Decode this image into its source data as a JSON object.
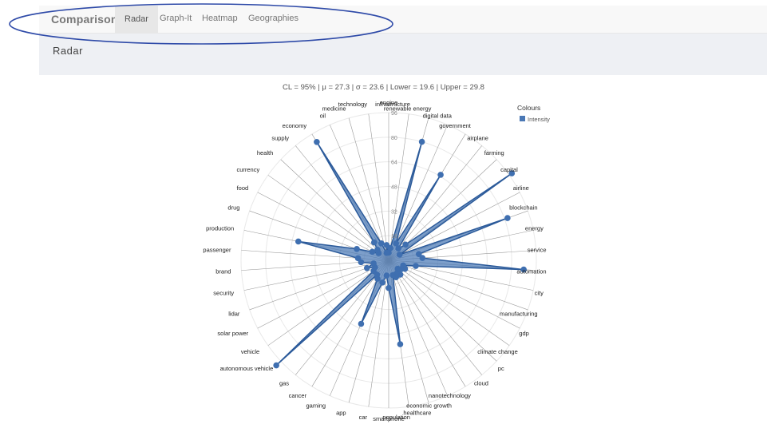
{
  "nav": {
    "brand": "Comparisons",
    "items": [
      "Radar",
      "Graph-It",
      "Heatmap",
      "Geographies"
    ],
    "active": "Radar"
  },
  "page_title": "Radar",
  "stats_line": "CL = 95% | μ = 27.3 | σ = 23.6 | Lower = 19.6 | Upper = 29.8",
  "chart_data": {
    "type": "radar",
    "legend": {
      "title": "Colours",
      "entries": [
        "Intensity"
      ],
      "placement": "top-right"
    },
    "radial_ticks": [
      16,
      32,
      48,
      64,
      80,
      96
    ],
    "radial_max": 96,
    "fill_color": "#4a78b5",
    "stroke_color": "#2b5a9a",
    "categories": [
      "engine",
      "infrastructure",
      "renewable energy",
      "digital data",
      "government",
      "airplane",
      "farming",
      "capital",
      "airline",
      "blockchain",
      "energy",
      "service",
      "automation",
      "city",
      "manufacturing",
      "gdp",
      "climate change",
      "pc",
      "cloud",
      "nanotechnology",
      "economic growth",
      "healthcare",
      "population",
      "smartphone",
      "car",
      "app",
      "gaming",
      "cancer",
      "gas",
      "autonomous vehicle",
      "vehicle",
      "solar power",
      "lidar",
      "security",
      "brand",
      "passenger",
      "production",
      "drug",
      "food",
      "currency",
      "health",
      "supply",
      "economy",
      "oil",
      "medicine",
      "technology"
    ],
    "series": [
      {
        "name": "Intensity",
        "values": [
          5,
          8,
          80,
          12,
          65,
          10,
          15,
          98,
          8,
          82,
          20,
          22,
          88,
          18,
          10,
          12,
          10,
          8,
          12,
          10,
          12,
          10,
          55,
          18,
          10,
          15,
          45,
          14,
          12,
          100,
          12,
          10,
          15,
          10,
          18,
          20,
          60,
          22,
          12,
          8,
          10,
          15,
          90,
          12,
          5,
          10
        ]
      }
    ]
  }
}
